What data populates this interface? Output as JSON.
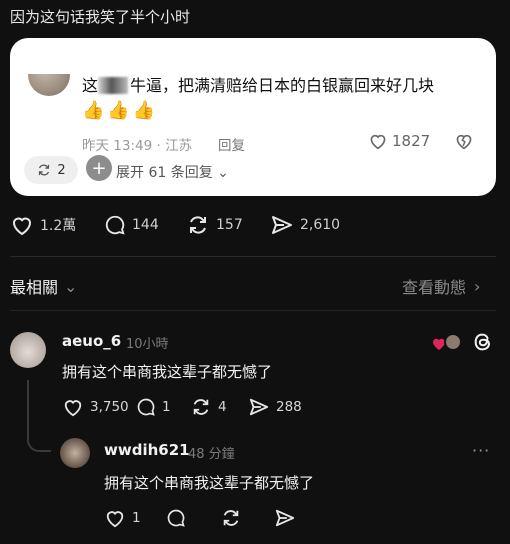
{
  "caption": "因为这句话我笑了半个小时",
  "card": {
    "text_rest": "牛逼，把满清赔给日本的白银赢回来好几块",
    "text_prefix": "这",
    "thumbs": "👍👍👍",
    "meta": "昨天 13:49 · 江苏",
    "reply_label": "回复",
    "likes": "1827",
    "reposts": "2",
    "expand_label": "展开 61 条回复",
    "expand_chevron": "⌄"
  },
  "post_actions": {
    "likes": "1.2萬",
    "comments": "144",
    "reposts": "157",
    "shares": "2,610"
  },
  "tabs": {
    "left_label": "最相關",
    "right_label": "查看動態",
    "left_chevron": "⌄",
    "right_chevron": "›"
  },
  "comments": [
    {
      "username": "aeuo_6",
      "time": "10小時",
      "text": "拥有这个串商我这辈子都无憾了",
      "likes": "3,750",
      "replies": "1",
      "reposts": "4",
      "shares": "288"
    },
    {
      "username": "wwdih621",
      "time": "48 分鐘",
      "text": "拥有这个串商我这辈子都无憾了",
      "likes": "1",
      "more": "···"
    }
  ],
  "colors": {
    "background": "#101010",
    "card": "#ffffff",
    "like_red": "#e0245e",
    "thumb": "#f6b53b"
  }
}
